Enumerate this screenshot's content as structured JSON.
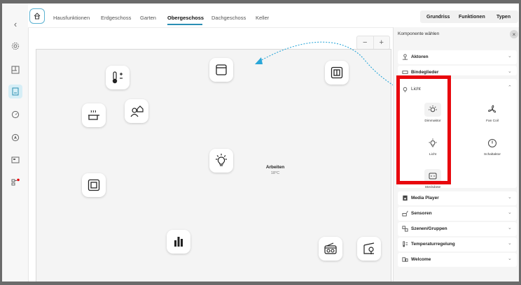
{
  "topbar": {
    "tabs": [
      "Hausfunktionen",
      "Erdgeschoss",
      "Garten",
      "Obergeschoss",
      "Dachgeschoss",
      "Keller"
    ],
    "active_tab": "Obergeschoss",
    "view_buttons": [
      "Grundriss",
      "Funktionen",
      "Typen"
    ]
  },
  "canvas": {
    "zoom_out": "−",
    "zoom_in": "+",
    "room_name": "Arbeiten",
    "room_temp": "18°C",
    "tiles": [
      "thermometer-icon",
      "blinds-icon",
      "window-icon",
      "cooking-pot-icon",
      "presence-icon",
      "light-bulb-icon",
      "window-frame-icon",
      "equalizer-icon",
      "radio-icon",
      "wallbox-icon"
    ]
  },
  "panel": {
    "title": "Komponente wählen",
    "close": "×",
    "categories": [
      {
        "label": "Aktoren",
        "icon": "actor-icon"
      },
      {
        "label": "Bindeglieder",
        "icon": "link-icon"
      },
      {
        "label": "Licht",
        "icon": "bulb-icon"
      }
    ],
    "licht_components": [
      {
        "label": "Dimmaktor",
        "icon": "dimmer-icon"
      },
      {
        "label": "Fan Coil",
        "icon": "fan-icon"
      },
      {
        "label": "Licht",
        "icon": "light-icon"
      },
      {
        "label": "Schaltaktor",
        "icon": "switch-actor-icon"
      },
      {
        "label": "Steckdose",
        "icon": "socket-icon"
      }
    ],
    "more_categories": [
      {
        "label": "Media Player",
        "icon": "media-player-icon"
      },
      {
        "label": "Sensoren",
        "icon": "sensor-icon"
      },
      {
        "label": "Szenen/Gruppen",
        "icon": "scenes-icon"
      },
      {
        "label": "Temperaturregelung",
        "icon": "temperature-icon"
      },
      {
        "label": "Welcome",
        "icon": "welcome-icon"
      }
    ]
  },
  "colors": {
    "accent": "#2b8fb5",
    "highlight": "#e8070d",
    "arrow": "#2aa6d8"
  }
}
